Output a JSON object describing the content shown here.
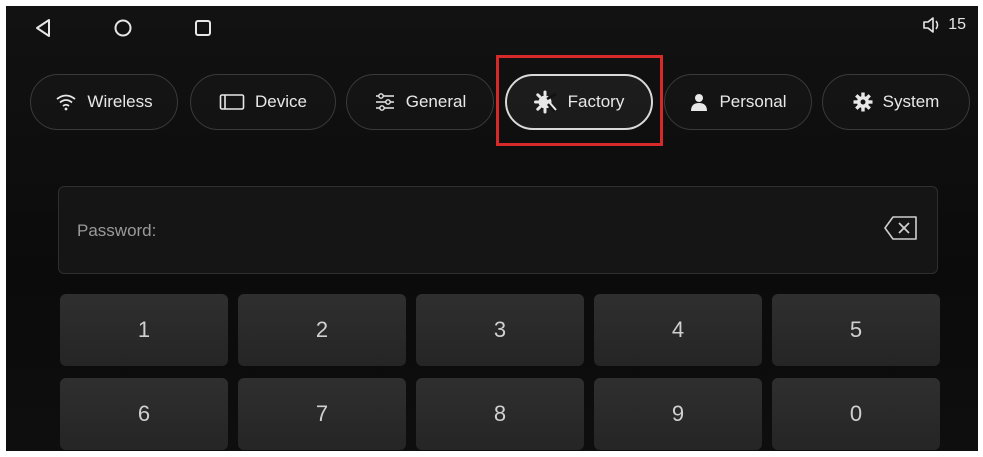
{
  "status": {
    "volume_value": "15"
  },
  "tabs": [
    {
      "label": "Wireless",
      "icon": "wifi-icon"
    },
    {
      "label": "Device",
      "icon": "device-icon"
    },
    {
      "label": "General",
      "icon": "sliders-icon"
    },
    {
      "label": "Factory",
      "icon": "factory-icon",
      "active": true
    },
    {
      "label": "Personal",
      "icon": "person-icon"
    },
    {
      "label": "System",
      "icon": "gear-icon"
    }
  ],
  "password": {
    "label": "Password:"
  },
  "keypad": {
    "keys": [
      "1",
      "2",
      "3",
      "4",
      "5",
      "6",
      "7",
      "8",
      "9",
      "0"
    ]
  },
  "colors": {
    "highlight": "#d62a2a",
    "background": "#0f0f0f",
    "key": "#2b2b2b"
  }
}
